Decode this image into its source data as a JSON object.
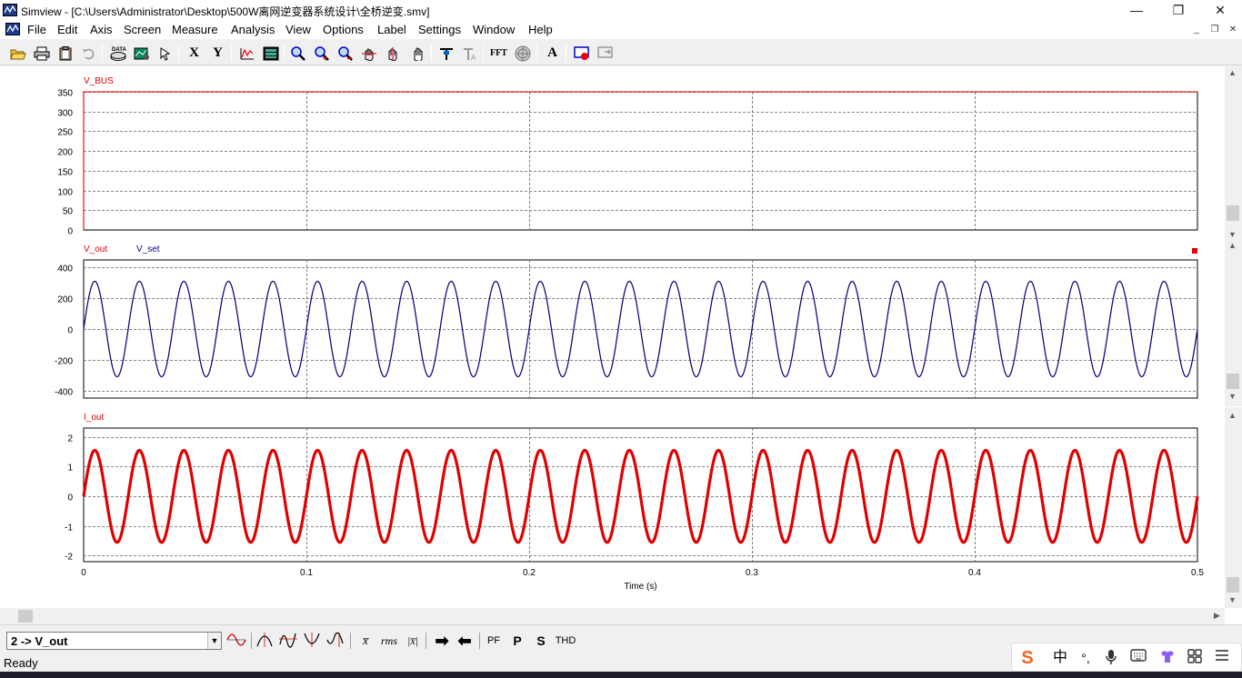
{
  "window": {
    "title": "Simview - [C:\\Users\\Administrator\\Desktop\\500W离网逆变器系统设计\\全桥逆变.smv]",
    "minimize_glyph": "—",
    "maximize_glyph": "❐",
    "close_glyph": "✕"
  },
  "menubar": {
    "items": [
      {
        "label": "File"
      },
      {
        "label": "Edit"
      },
      {
        "label": "Axis"
      },
      {
        "label": "Screen"
      },
      {
        "label": "Measure"
      },
      {
        "label": "Analysis"
      },
      {
        "label": "View"
      },
      {
        "label": "Options"
      },
      {
        "label": "Label"
      },
      {
        "label": "Settings"
      },
      {
        "label": "Window"
      },
      {
        "label": "Help"
      }
    ],
    "mdi_minimize": "_",
    "mdi_restore": "❐",
    "mdi_close": "✕"
  },
  "toolbar": {
    "x_label": "X",
    "y_label": "Y",
    "fft_label": "FFT",
    "text_label": "A",
    "data_label": "DATA"
  },
  "colors": {
    "red": "#e00000",
    "blue": "#00008b",
    "grid": "#606060"
  },
  "chart_data": [
    {
      "type": "line",
      "series": [
        {
          "name": "V_BUS",
          "color": "#e00000",
          "constant": 350
        }
      ],
      "ylim": [
        0,
        350
      ],
      "yticks": [
        0,
        50,
        100,
        150,
        200,
        250,
        300,
        350
      ],
      "xlim": [
        0,
        0.5
      ],
      "grid": true
    },
    {
      "type": "line",
      "series": [
        {
          "name": "V_out",
          "color": "#e00000",
          "amplitude": 311,
          "frequency_hz": 50
        },
        {
          "name": "V_set",
          "color": "#00008b",
          "amplitude": 311,
          "frequency_hz": 50
        }
      ],
      "ylim": [
        -450,
        450
      ],
      "yticks": [
        -400,
        -200,
        0,
        200,
        400
      ],
      "xlim": [
        0,
        0.5
      ],
      "grid": true
    },
    {
      "type": "line",
      "series": [
        {
          "name": "I_out",
          "color": "#e00000",
          "amplitude": 1.55,
          "frequency_hz": 50
        }
      ],
      "ylim": [
        -2.2,
        2.3
      ],
      "yticks": [
        -2,
        -1,
        0,
        1,
        2
      ],
      "xlim": [
        0,
        0.5
      ],
      "xticks": [
        0,
        0.1,
        0.2,
        0.3,
        0.4,
        0.5
      ],
      "xlabel": "Time (s)",
      "grid": true
    }
  ],
  "bottombar": {
    "curve_select_value": "2 -> V_out",
    "rms_label": "rms",
    "pf_label": "PF",
    "p_label": "P",
    "s_label": "S",
    "thd_label": "THD"
  },
  "statusbar": {
    "status_text": "Ready"
  },
  "ime": {
    "zh_label": "中",
    "punct_label": "°,"
  }
}
